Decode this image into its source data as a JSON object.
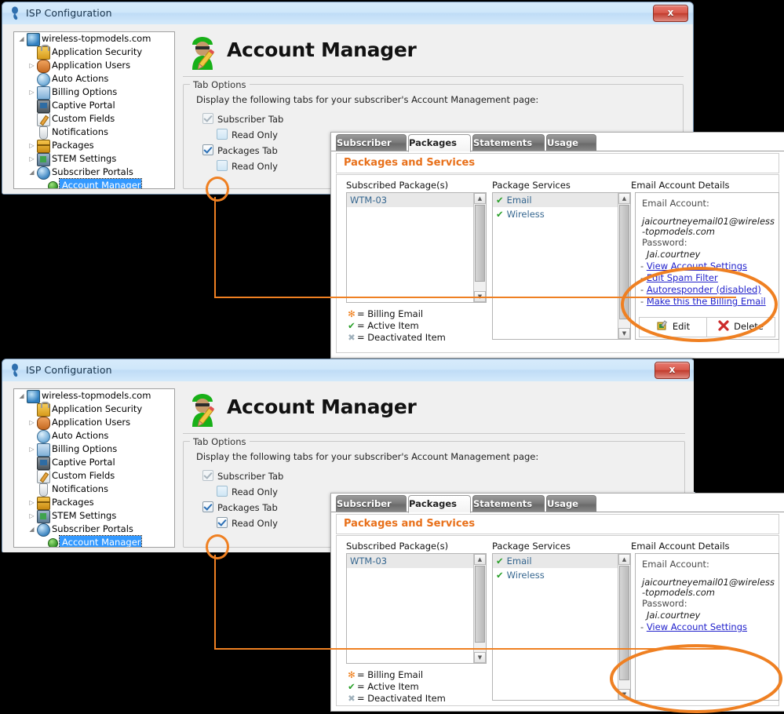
{
  "window": {
    "title": "ISP Configuration",
    "close_label": "x"
  },
  "tree": {
    "items": [
      {
        "label": "wireless-topmodels.com",
        "icon": "globe-icon",
        "expander": "expanded",
        "indent": 0
      },
      {
        "label": "Application Security",
        "icon": "lock-icon",
        "expander": "none",
        "indent": 1
      },
      {
        "label": "Application Users",
        "icon": "users-icon",
        "expander": "collapsed",
        "indent": 1
      },
      {
        "label": "Auto Actions",
        "icon": "clock-icon",
        "expander": "none",
        "indent": 1
      },
      {
        "label": "Billing Options",
        "icon": "billing-icon",
        "expander": "collapsed",
        "indent": 1
      },
      {
        "label": "Captive Portal",
        "icon": "portal-icon",
        "expander": "none",
        "indent": 1
      },
      {
        "label": "Custom Fields",
        "icon": "custom-fields-icon",
        "expander": "none",
        "indent": 1
      },
      {
        "label": "Notifications",
        "icon": "notifications-icon",
        "expander": "none",
        "indent": 1
      },
      {
        "label": "Packages",
        "icon": "packages-icon",
        "expander": "collapsed",
        "indent": 1
      },
      {
        "label": "STEM Settings",
        "icon": "stem-icon",
        "expander": "collapsed",
        "indent": 1
      },
      {
        "label": "Subscriber Portals",
        "icon": "subscriber-portals-icon",
        "expander": "expanded",
        "indent": 1
      },
      {
        "label": "Account Manager",
        "icon": "green-dot-icon",
        "expander": "none",
        "indent": 2,
        "selected": true
      }
    ]
  },
  "page": {
    "heading": "Account Manager",
    "group_label": "Tab Options",
    "instruction": "Display the following tabs for your subscriber's Account Management page:",
    "checkboxes": [
      {
        "label": "Subscriber Tab",
        "checked": true,
        "disabled": true
      },
      {
        "label": "Read Only",
        "checked": false,
        "disabled": false
      },
      {
        "label": "Packages Tab",
        "checked": true,
        "disabled": false
      },
      {
        "label": "Read Only",
        "checked": false,
        "disabled": false
      }
    ],
    "checkboxes_bottom": [
      {
        "label": "Subscriber Tab",
        "checked": true,
        "disabled": true
      },
      {
        "label": "Read Only",
        "checked": false,
        "disabled": false
      },
      {
        "label": "Packages Tab",
        "checked": true,
        "disabled": false
      },
      {
        "label": "Read Only",
        "checked": true,
        "disabled": false
      }
    ]
  },
  "portal": {
    "tabs": [
      {
        "label": "Subscriber",
        "active": false
      },
      {
        "label": "Packages",
        "active": true
      },
      {
        "label": "Statements",
        "active": false
      },
      {
        "label": "Usage",
        "active": false
      }
    ],
    "section_title": "Packages and Services",
    "columns": {
      "packages": "Subscribed Package(s)",
      "services": "Package Services",
      "email": "Email Account Details"
    },
    "subscribed_packages": [
      "WTM-03"
    ],
    "package_services": [
      "Email",
      "Wireless"
    ],
    "legend": [
      {
        "glyph": "✻",
        "text": "= Billing Email",
        "color": "#f07d18"
      },
      {
        "glyph": "✔",
        "text": "= Active Item",
        "color": "#2aa02a"
      },
      {
        "glyph": "✖",
        "text": "= Deactivated Item",
        "color": "#9fb0bb"
      }
    ],
    "email_details": {
      "account_label": "Email Account:",
      "account_value": "jaicourtneyemail01@wireless-topmodels.com",
      "password_label": "Password:",
      "password_value": "Jai.courtney",
      "links_top": [
        "View Account Settings",
        "Edit Spam Filter",
        "Autoresponder (disabled)",
        "Make this the Billing Email"
      ],
      "links_bottom": [
        "View Account Settings"
      ],
      "buttons": [
        {
          "label": "Edit",
          "icon": "edit-icon"
        },
        {
          "label": "Delete",
          "icon": "delete-icon"
        }
      ]
    }
  },
  "colors": {
    "accent_orange": "#ef8022",
    "section_orange": "#e8701a",
    "link_blue": "#2222cc",
    "selection_blue": "#3399ff",
    "tick_green": "#2aa02a"
  }
}
